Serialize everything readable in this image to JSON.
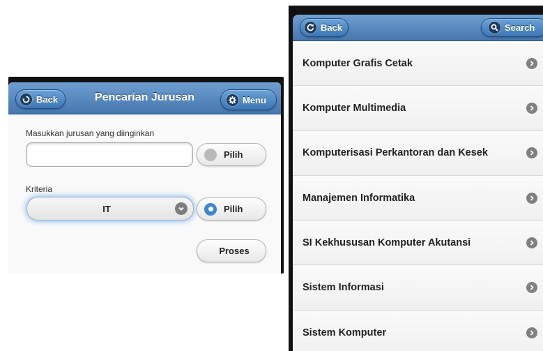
{
  "left_screen": {
    "header": {
      "back_label": "Back",
      "title": "Pencarian Jurusan",
      "menu_label": "Menu",
      "back_icon": "back-arrow-icon",
      "menu_icon": "gear-icon"
    },
    "form": {
      "jurusan_label": "Masukkan jurusan yang diinginkan",
      "jurusan_value": "",
      "jurusan_placeholder": "",
      "pilih_1_label": "Pilih",
      "pilih_1_selected": false,
      "kriteria_label": "Kriteria",
      "kriteria_selected": "IT",
      "pilih_2_label": "Pilih",
      "pilih_2_selected": true,
      "proses_label": "Proses"
    }
  },
  "right_screen": {
    "header": {
      "back_label": "Back",
      "search_label": "Search",
      "back_icon": "refresh-back-icon",
      "search_icon": "search-icon"
    },
    "items": [
      "Komputer Grafis Cetak",
      "Komputer Multimedia",
      "Komputerisasi Perkantoran dan Kesek",
      "Manajemen Informatika",
      "SI Kekhususan Komputer Akutansi",
      "Sistem Informasi",
      "Sistem Komputer"
    ]
  },
  "colors": {
    "header_blue": "#4576ad",
    "accent_blue": "#3d86d0",
    "frame": "#111111"
  }
}
